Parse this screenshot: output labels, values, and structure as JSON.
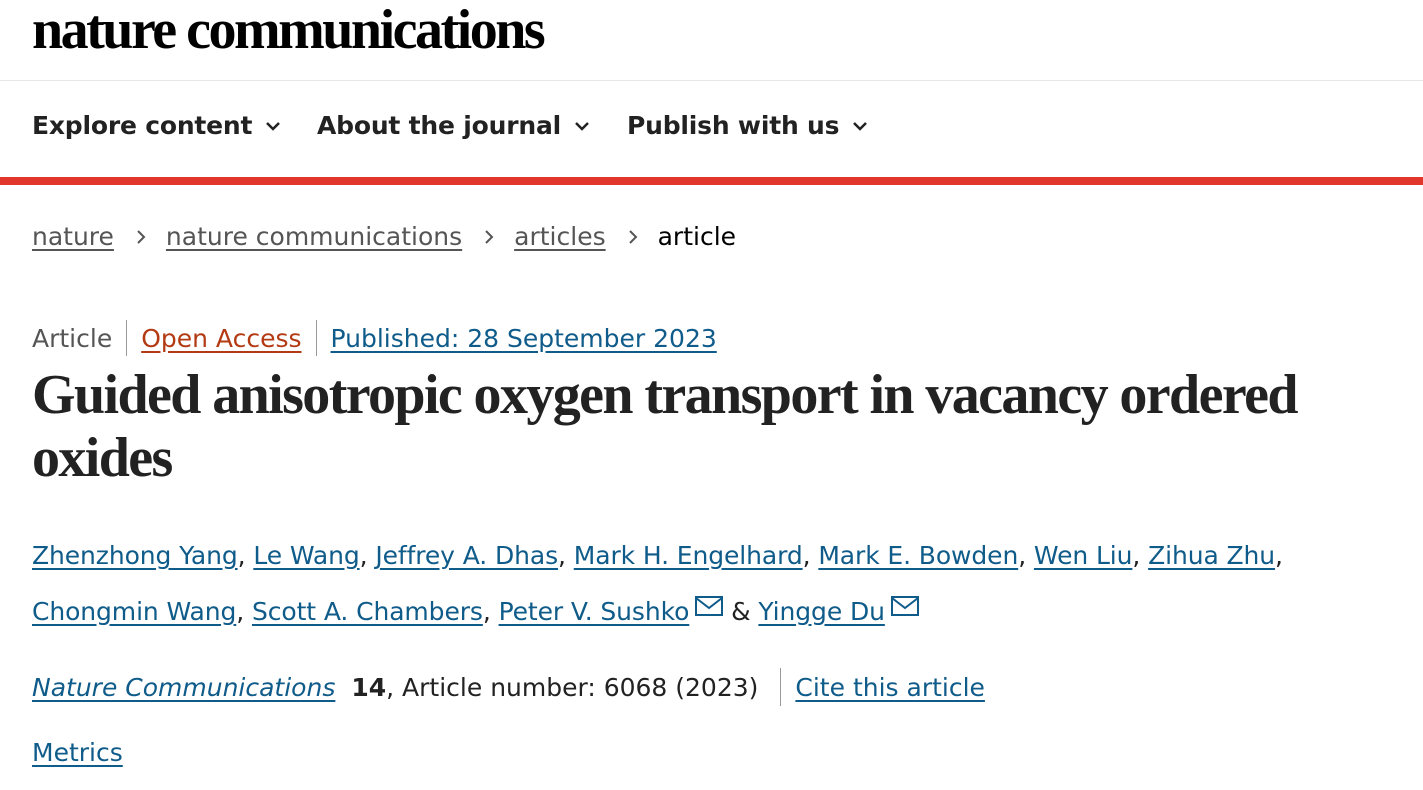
{
  "header": {
    "brand": "nature communications"
  },
  "nav": {
    "items": [
      {
        "label": "Explore content"
      },
      {
        "label": "About the journal"
      },
      {
        "label": "Publish with us"
      }
    ]
  },
  "breadcrumb": {
    "items": [
      "nature",
      "nature communications",
      "articles"
    ],
    "current": "article"
  },
  "article_meta": {
    "type": "Article",
    "access": "Open Access",
    "published": "Published: 28 September 2023"
  },
  "title": "Guided anisotropic oxygen transport in vacancy ordered oxides",
  "authors": [
    "Zhenzhong Yang",
    "Le Wang",
    "Jeffrey A. Dhas",
    "Mark H. Engelhard",
    "Mark E. Bowden",
    "Wen Liu",
    "Zihua Zhu",
    "Chongmin Wang",
    "Scott A. Chambers",
    "Peter V. Sushko",
    "Yingge Du"
  ],
  "separators": {
    "comma": ",",
    "amp": "&"
  },
  "citation": {
    "journal": "Nature Communications",
    "volume": "14",
    "rest": ", Article number: 6068 (2023)",
    "cite_label": "Cite this article"
  },
  "metrics_label": "Metrics",
  "colors": {
    "accent_red": "#e0362c",
    "link_blue": "#0f5b8a",
    "open_access": "#b33a13"
  },
  "icons": {
    "nav_chevron": "chevron-down-icon",
    "breadcrumb_sep": "chevron-right-icon",
    "author_email": "mail-icon"
  }
}
